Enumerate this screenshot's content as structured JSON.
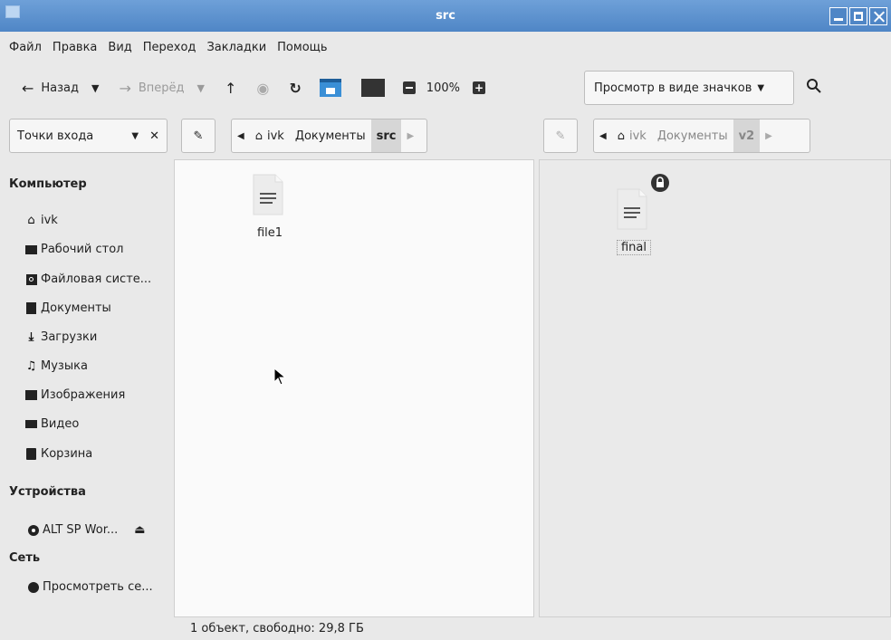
{
  "window": {
    "title": "src"
  },
  "menu": [
    "Файл",
    "Правка",
    "Вид",
    "Переход",
    "Закладки",
    "Помощь"
  ],
  "toolbar": {
    "back": "Назад",
    "forward": "Вперёд",
    "zoom": "100%",
    "view_mode": "Просмотр в виде значков"
  },
  "places_select": "Точки входа",
  "left_path": [
    "ivk",
    "Документы",
    "src"
  ],
  "right_path": [
    "ivk",
    "Документы",
    "v2"
  ],
  "sidebar": {
    "computer_header": "Компьютер",
    "computer_items": [
      {
        "label": "ivk",
        "icon": "home-icon"
      },
      {
        "label": "Рабочий стол",
        "icon": "desktop-icon"
      },
      {
        "label": "Файловая систе...",
        "icon": "drive-icon"
      },
      {
        "label": "Документы",
        "icon": "document-icon"
      },
      {
        "label": "Загрузки",
        "icon": "download-icon"
      },
      {
        "label": "Музыка",
        "icon": "music-icon"
      },
      {
        "label": "Изображения",
        "icon": "image-icon"
      },
      {
        "label": "Видео",
        "icon": "video-icon"
      },
      {
        "label": "Корзина",
        "icon": "trash-icon"
      }
    ],
    "devices_header": "Устройства",
    "device_item": "ALT SP Wor...",
    "network_header": "Сеть",
    "network_item": "Просмотреть се..."
  },
  "left_pane": {
    "files": [
      {
        "name": "file1"
      }
    ]
  },
  "right_pane": {
    "files": [
      {
        "name": "final",
        "locked": true
      }
    ]
  },
  "status": "1 объект, свободно: 29,8 ГБ"
}
